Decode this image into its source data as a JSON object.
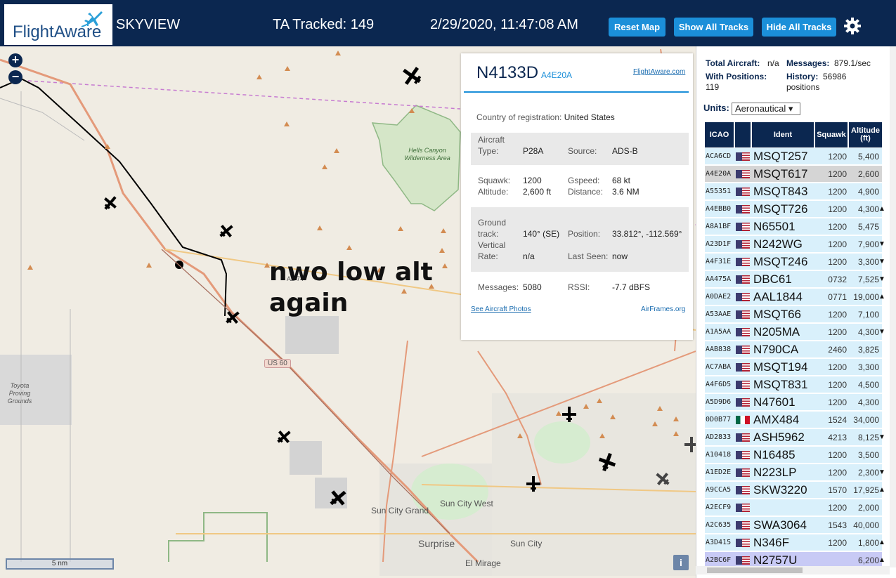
{
  "header": {
    "logo_text": "FlightAware",
    "title": "SKYVIEW",
    "tracked": "TA Tracked: 149",
    "datetime": "2/29/2020, 11:47:08 AM",
    "buttons": {
      "reset": "Reset Map",
      "show": "Show All Tracks",
      "hide": "Hide All Tracks"
    }
  },
  "map": {
    "annotation_line1": "nwo low alt",
    "annotation_line2": "again",
    "labels": {
      "hells_canyon": "Hells Canyon Wilderness Area",
      "toyota": "Toyota Proving Grounds",
      "sun_city_grand": "Sun City Grand",
      "sun_city_west": "Sun City West",
      "sun_city": "Sun City",
      "surprise": "Surprise",
      "el_mirage": "El Mirage",
      "us60": "US 60",
      "az74": "AZ 74"
    },
    "scale": "5 nm",
    "info_icon": "i"
  },
  "popup": {
    "registration": "N4133D",
    "hex": "A4E20A",
    "link": "FlightAware.com",
    "country_label": "Country of registration:",
    "country": "United States",
    "aircraft_type_label1": "Aircraft",
    "aircraft_type_label2": "Type:",
    "aircraft_type": "P28A",
    "source_label": "Source:",
    "source": "ADS-B",
    "squawk_label": "Squawk:",
    "squawk": "1200",
    "gspeed_label": "Gspeed:",
    "gspeed": "68 kt",
    "altitude_label": "Altitude:",
    "altitude": "2,600 ft",
    "distance_label": "Distance:",
    "distance": "3.6 NM",
    "ground_label1": "Ground",
    "ground_label2": "track:",
    "ground_track": "140° (SE)",
    "position_label": "Position:",
    "position": "33.812°, -112.569°",
    "vrate_label1": "Vertical",
    "vrate_label2": "Rate:",
    "vrate": "n/a",
    "lastseen_label": "Last Seen:",
    "lastseen": "now",
    "messages_label": "Messages:",
    "messages": "5080",
    "rssi_label": "RSSI:",
    "rssi": "-7.7 dBFS",
    "photos_link": "See Aircraft Photos",
    "airframes_link": "AirFrames.org"
  },
  "panel": {
    "total_label": "Total Aircraft:",
    "total": "n/a",
    "messages_label": "Messages:",
    "messages": "879.1/sec",
    "withpos_label": "With Positions:",
    "withpos": "119",
    "history_label": "History:",
    "history": "56986",
    "history_unit": "positions",
    "units_label": "Units:",
    "units_value": "Aeronautical ▾",
    "columns": {
      "icao": "ICAO",
      "ident": "Ident",
      "squawk": "Squawk",
      "alt1": "Altitude",
      "alt2": "(ft)"
    },
    "rows": [
      {
        "icao": "ACA6CD",
        "flag": "us",
        "ident": "MSQT257",
        "squawk": "1200",
        "alt": "5,400",
        "arrow": ""
      },
      {
        "icao": "A4E20A",
        "flag": "us",
        "ident": "MSQT617",
        "squawk": "1200",
        "alt": "2,600",
        "arrow": ""
      },
      {
        "icao": "A55351",
        "flag": "us",
        "ident": "MSQT843",
        "squawk": "1200",
        "alt": "4,900",
        "arrow": ""
      },
      {
        "icao": "A4EBB0",
        "flag": "us",
        "ident": "MSQT726",
        "squawk": "1200",
        "alt": "4,300",
        "arrow": "▲"
      },
      {
        "icao": "A8A1BF",
        "flag": "us",
        "ident": "N65501",
        "squawk": "1200",
        "alt": "5,475",
        "arrow": ""
      },
      {
        "icao": "A23D1F",
        "flag": "us",
        "ident": "N242WG",
        "squawk": "1200",
        "alt": "7,900",
        "arrow": "▼"
      },
      {
        "icao": "A4F31E",
        "flag": "us",
        "ident": "MSQT246",
        "squawk": "1200",
        "alt": "3,300",
        "arrow": "▼"
      },
      {
        "icao": "AA475A",
        "flag": "us",
        "ident": "DBC61",
        "squawk": "0732",
        "alt": "7,525",
        "arrow": "▼"
      },
      {
        "icao": "A0DAE2",
        "flag": "us",
        "ident": "AAL1844",
        "squawk": "0771",
        "alt": "19,000",
        "arrow": "▲"
      },
      {
        "icao": "A53AAE",
        "flag": "us",
        "ident": "MSQT66",
        "squawk": "1200",
        "alt": "7,100",
        "arrow": ""
      },
      {
        "icao": "A1A5AA",
        "flag": "us",
        "ident": "N205MA",
        "squawk": "1200",
        "alt": "4,300",
        "arrow": "▼"
      },
      {
        "icao": "AAB838",
        "flag": "us",
        "ident": "N790CA",
        "squawk": "2460",
        "alt": "3,825",
        "arrow": ""
      },
      {
        "icao": "AC7ABA",
        "flag": "us",
        "ident": "MSQT194",
        "squawk": "1200",
        "alt": "3,300",
        "arrow": ""
      },
      {
        "icao": "A4F6D5",
        "flag": "us",
        "ident": "MSQT831",
        "squawk": "1200",
        "alt": "4,500",
        "arrow": ""
      },
      {
        "icao": "A5D9D6",
        "flag": "us",
        "ident": "N47601",
        "squawk": "1200",
        "alt": "4,300",
        "arrow": ""
      },
      {
        "icao": "0D0B77",
        "flag": "mx",
        "ident": "AMX484",
        "squawk": "1524",
        "alt": "34,000",
        "arrow": ""
      },
      {
        "icao": "AD2833",
        "flag": "us",
        "ident": "ASH5962",
        "squawk": "4213",
        "alt": "8,125",
        "arrow": "▼"
      },
      {
        "icao": "A10418",
        "flag": "us",
        "ident": "N16485",
        "squawk": "1200",
        "alt": "3,500",
        "arrow": ""
      },
      {
        "icao": "A1ED2E",
        "flag": "us",
        "ident": "N223LP",
        "squawk": "1200",
        "alt": "2,300",
        "arrow": "▼"
      },
      {
        "icao": "A9CCA5",
        "flag": "us",
        "ident": "SKW3220",
        "squawk": "1570",
        "alt": "17,925",
        "arrow": "▲"
      },
      {
        "icao": "A2ECF9",
        "flag": "us",
        "ident": "",
        "squawk": "1200",
        "alt": "2,000",
        "arrow": ""
      },
      {
        "icao": "A2C635",
        "flag": "us",
        "ident": "SWA3064",
        "squawk": "1543",
        "alt": "40,000",
        "arrow": ""
      },
      {
        "icao": "A3D415",
        "flag": "us",
        "ident": "N346F",
        "squawk": "1200",
        "alt": "1,800",
        "arrow": "▲"
      },
      {
        "icao": "A2BC6F",
        "flag": "us",
        "ident": "N2757U",
        "squawk": "",
        "alt": "6,200",
        "arrow": "▲"
      }
    ]
  },
  "colors": {
    "header_bg": "#0b2750",
    "button": "#1b8fd9",
    "row_bg": "#d9f0fb",
    "selected_row": "#d5d5d5"
  }
}
